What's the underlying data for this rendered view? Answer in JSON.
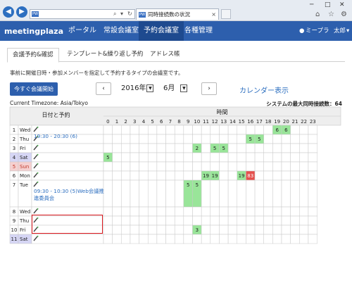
{
  "browser": {
    "tab_title": "同時接続数の状況",
    "fav": "PW"
  },
  "nav": {
    "logo": "meetingplaza",
    "items": [
      "ポータル",
      "常設会議室",
      "予約会議室",
      "各種管理"
    ],
    "user1": "ミープラ",
    "user2": "太郎"
  },
  "tabs": [
    "会議予約&確認",
    "テンプレート&繰り返し予約",
    "アドレス帳"
  ],
  "description": "事前に開催日時・参加メンバーを指定して予約するタイプの会議室です。",
  "start_button": "今すぐ会議開始",
  "year": "2016年",
  "month": "6月",
  "calendar_link": "カレンダー表示",
  "timezone": "Current Timezone: Asia/Tokyo",
  "max_concurrent": "システムの最大同時接続数：64",
  "header_day": "日付と予約",
  "header_time": "時間",
  "colors": {
    "green": "#99e599",
    "red": "#e5504d",
    "sat": "#d6d6f5",
    "sun": "#f5d0d0"
  },
  "days": [
    {
      "n": "1",
      "w": "Wed",
      "cells": {
        "19": "6",
        "20": "6"
      },
      "res": [
        "19:30 - 20:30 (6)"
      ]
    },
    {
      "n": "2",
      "w": "Thu",
      "cells": {
        "16": "5",
        "17": "5"
      }
    },
    {
      "n": "3",
      "w": "Fri",
      "cells": {
        "10": "2",
        "12": "5",
        "13": "5"
      }
    },
    {
      "n": "4",
      "w": "Sat",
      "cells": {
        "0": "5"
      }
    },
    {
      "n": "5",
      "w": "Sun",
      "cells": {}
    },
    {
      "n": "6",
      "w": "Mon",
      "cells": {
        "11": "19",
        "12": "19",
        "15": "19",
        "16": "83"
      }
    },
    {
      "n": "7",
      "w": "Tue",
      "cells": {
        "9": "5",
        "10": "5"
      },
      "res": [
        "09:30 - 10:30 (5)Web会議推",
        "進委員会"
      ]
    },
    {
      "n": "8",
      "w": "Wed",
      "cells": {}
    },
    {
      "n": "9",
      "w": "Thu",
      "cells": {}
    },
    {
      "n": "10",
      "w": "Fri",
      "cells": {
        "10": "3"
      }
    },
    {
      "n": "11",
      "w": "Sat",
      "cells": {}
    }
  ]
}
